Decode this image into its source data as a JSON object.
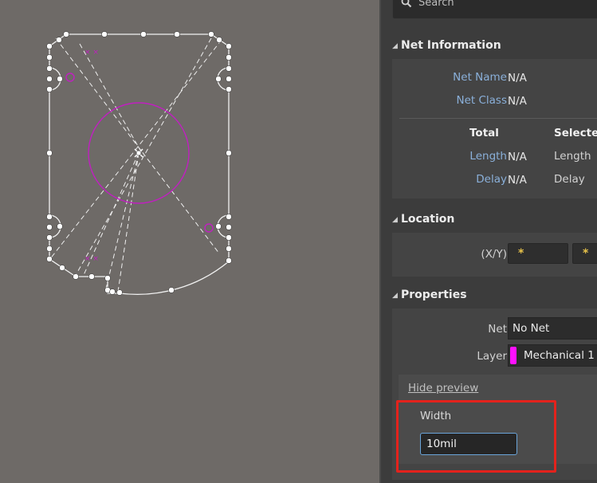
{
  "search": {
    "placeholder": "Search"
  },
  "net_information": {
    "title": "Net Information",
    "net_name_label": "Net Name",
    "net_name_value": "N/A",
    "net_class_label": "Net Class",
    "net_class_value": "N/A",
    "col_total": "Total",
    "col_selected": "Selected",
    "length_label": "Length",
    "length_total": "N/A",
    "length_selected": "Length",
    "delay_label": "Delay",
    "delay_total": "N/A",
    "delay_selected": "Delay"
  },
  "location": {
    "title": "Location",
    "xy_label": "(X/Y)",
    "x_value": "*",
    "y_value": "*"
  },
  "properties": {
    "title": "Properties",
    "net_label": "Net",
    "net_value": "No Net",
    "layer_label": "Layer",
    "layer_value": "Mechanical 1",
    "layer_color": "#ff10ff",
    "hide_preview": "Hide preview",
    "width_label": "Width",
    "width_value": "10mil"
  },
  "colors": {
    "canvas_bg": "#6e6a67",
    "panel_bg": "#3c3c3c",
    "outline": "#ffffff",
    "mechanical_magenta": "#c020c0",
    "highlight_red": "#e4221c"
  }
}
